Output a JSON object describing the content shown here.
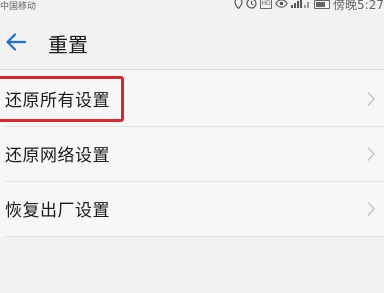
{
  "status_bar": {
    "carrier": "中国移动",
    "time": "傍晚5:27",
    "icons": [
      "location-icon",
      "alarm-icon",
      "hd-icon",
      "eye-icon",
      "signal-icon",
      "battery-icon"
    ]
  },
  "header": {
    "title": "重置",
    "back_icon": "back-arrow-icon",
    "accent_color": "#1e6fd9"
  },
  "list": {
    "items": [
      {
        "label": "还原所有设置",
        "highlighted": true
      },
      {
        "label": "还原网络设置",
        "highlighted": false
      },
      {
        "label": "恢复出厂设置",
        "highlighted": false
      }
    ],
    "chevron_icon": "chevron-right-icon"
  },
  "highlight_color": "#d9282d"
}
